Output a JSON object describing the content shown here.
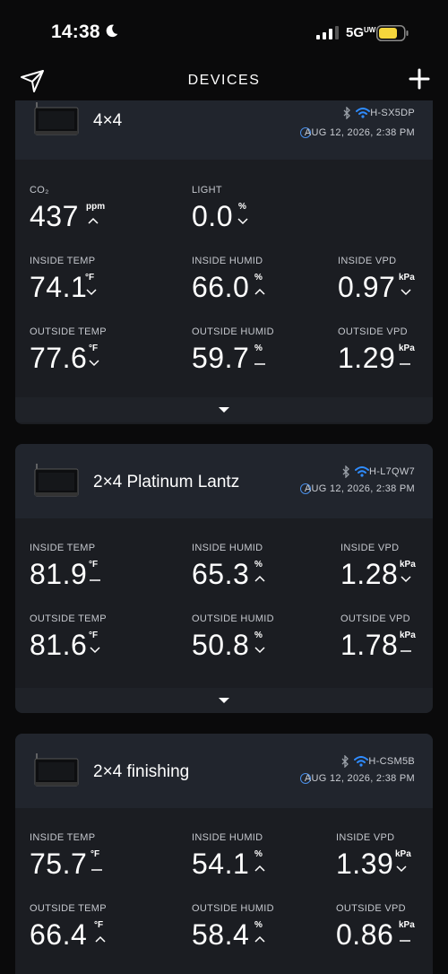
{
  "status": {
    "time": "14:38",
    "network": "5G",
    "network_sup": "UW"
  },
  "nav": {
    "title": "DEVICES"
  },
  "devices": [
    {
      "name": "4×4",
      "id": "H-SX5DP",
      "updated": "AUG 12, 2026, 2:38 PM",
      "metrics": [
        {
          "label": "CO₂",
          "value": "437",
          "unit": "ppm",
          "trend": "up"
        },
        {
          "label": "LIGHT",
          "value": "0.0",
          "unit": "%",
          "trend": "down"
        },
        {
          "label": "INSIDE TEMP",
          "value": "74.1",
          "unit": "°F",
          "trend": "down"
        },
        {
          "label": "INSIDE HUMID",
          "value": "66.0",
          "unit": "%",
          "trend": "up"
        },
        {
          "label": "INSIDE VPD",
          "value": "0.97",
          "unit": "kPa",
          "trend": "down"
        },
        {
          "label": "OUTSIDE TEMP",
          "value": "77.6",
          "unit": "°F",
          "trend": "down"
        },
        {
          "label": "OUTSIDE HUMID",
          "value": "59.7",
          "unit": "%",
          "trend": "flat"
        },
        {
          "label": "OUTSIDE VPD",
          "value": "1.29",
          "unit": "kPa",
          "trend": "flat"
        }
      ]
    },
    {
      "name": "2×4 Platinum Lantz",
      "id": "H-L7QW7",
      "updated": "AUG 12, 2026, 2:38 PM",
      "metrics": [
        {
          "label": "INSIDE TEMP",
          "value": "81.9",
          "unit": "°F",
          "trend": "flat"
        },
        {
          "label": "INSIDE HUMID",
          "value": "65.3",
          "unit": "%",
          "trend": "up"
        },
        {
          "label": "INSIDE VPD",
          "value": "1.28",
          "unit": "kPa",
          "trend": "down"
        },
        {
          "label": "OUTSIDE TEMP",
          "value": "81.6",
          "unit": "°F",
          "trend": "down"
        },
        {
          "label": "OUTSIDE HUMID",
          "value": "50.8",
          "unit": "%",
          "trend": "down"
        },
        {
          "label": "OUTSIDE VPD",
          "value": "1.78",
          "unit": "kPa",
          "trend": "flat"
        }
      ]
    },
    {
      "name": "2×4 finishing",
      "id": "H-CSM5B",
      "updated": "AUG 12, 2026, 2:38 PM",
      "metrics": [
        {
          "label": "INSIDE TEMP",
          "value": "75.7",
          "unit": "°F",
          "trend": "flat"
        },
        {
          "label": "INSIDE HUMID",
          "value": "54.1",
          "unit": "%",
          "trend": "up"
        },
        {
          "label": "INSIDE VPD",
          "value": "1.39",
          "unit": "kPa",
          "trend": "down"
        },
        {
          "label": "OUTSIDE TEMP",
          "value": "66.4",
          "unit": "°F",
          "trend": "up"
        },
        {
          "label": "OUTSIDE HUMID",
          "value": "58.4",
          "unit": "%",
          "trend": "up"
        },
        {
          "label": "OUTSIDE VPD",
          "value": "0.86",
          "unit": "kPa",
          "trend": "flat"
        }
      ]
    }
  ],
  "colors": {
    "accent_blue": "#2f8cff",
    "battery": "#f5d63c",
    "card": "#1b1d22",
    "card_header": "#21252d"
  }
}
